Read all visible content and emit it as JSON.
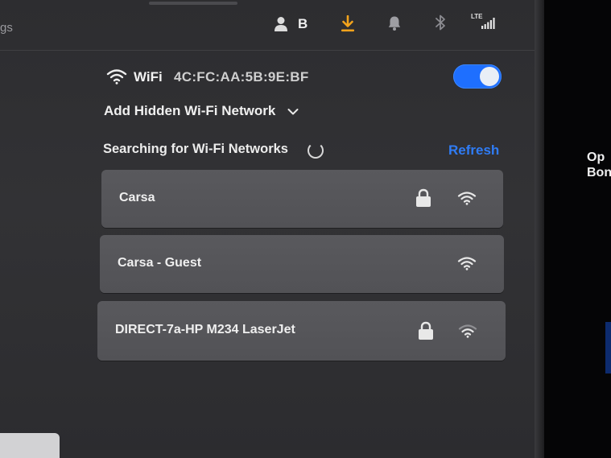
{
  "status_bar": {
    "crumb": "gs",
    "user_initial": "B",
    "cell_label": "LTE",
    "icons": [
      "user-icon",
      "download-icon",
      "bell-icon",
      "bluetooth-icon",
      "lte-signal-icon"
    ],
    "download_color": "#f2a31c"
  },
  "wifi": {
    "label": "WiFi",
    "mac": "4C:FC:AA:5B:9E:BF",
    "enabled": true,
    "toggle_color": "#1e6fff"
  },
  "add_hidden": {
    "label": "Add Hidden Wi-Fi Network"
  },
  "scan": {
    "status": "Searching for Wi-Fi Networks",
    "refresh_label": "Refresh",
    "refresh_color": "#2f7cf6"
  },
  "networks": [
    {
      "name": "Carsa",
      "secured": true,
      "signal": 3
    },
    {
      "name": "Carsa - Guest",
      "secured": false,
      "signal": 3
    },
    {
      "name": "DIRECT-7a-HP M234 LaserJet",
      "secured": true,
      "signal": 2
    }
  ],
  "edge_text": "Op\nBon"
}
